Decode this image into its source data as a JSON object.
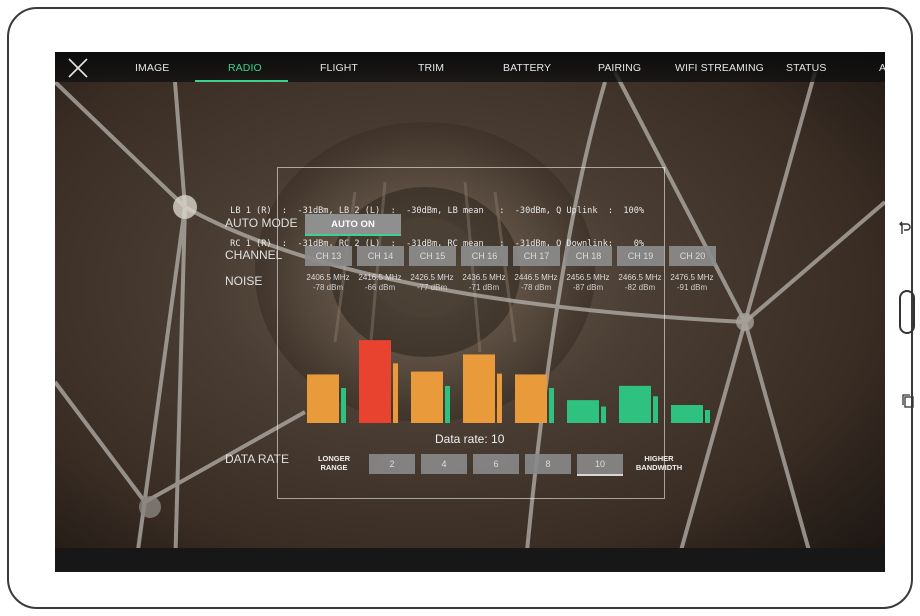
{
  "nav": {
    "tabs": [
      "IMAGE",
      "RADIO",
      "FLIGHT",
      "TRIM",
      "BATTERY",
      "PAIRING",
      "WIFI STREAMING",
      "STATUS",
      "A"
    ],
    "active_tab": "RADIO",
    "close_icon": "close-icon"
  },
  "stats": {
    "line1": " LB 1 (R)  :  -31dBm, LB 2 (L)  :  -30dBm, LB mean   :  -30dBm, Q Uplink  :  100%",
    "line2": " RC 1 (R)  :  -31dBm, RC 2 (L)  :  -31dBm, RC mean   :  -31dBm, Q Downlink:    0%"
  },
  "labels": {
    "auto_mode": "AUTO MODE",
    "channel": "CHANNEL",
    "noise": "NOISE",
    "data_rate": "DATA RATE"
  },
  "auto_button": "AUTO ON",
  "channels": [
    {
      "name": "CH 13",
      "freq": "2406.5 MHz",
      "noise": "-78 dBm"
    },
    {
      "name": "CH 14",
      "freq": "2416.5 MHz",
      "noise": "-66 dBm"
    },
    {
      "name": "CH 15",
      "freq": "2426.5 MHz",
      "noise": "-77 dBm"
    },
    {
      "name": "CH 16",
      "freq": "2436.5 MHz",
      "noise": "-71 dBm"
    },
    {
      "name": "CH 17",
      "freq": "2446.5 MHz",
      "noise": "-78 dBm"
    },
    {
      "name": "CH 18",
      "freq": "2456.5 MHz",
      "noise": "-87 dBm"
    },
    {
      "name": "CH 19",
      "freq": "2466.5 MHz",
      "noise": "-82 dBm"
    },
    {
      "name": "CH 20",
      "freq": "2476.5 MHz",
      "noise": "-91 dBm"
    }
  ],
  "data_rate": {
    "title": "Data rate: 10",
    "longer_range": "LONGER RANGE",
    "higher_bandwidth": "HIGHER BANDWIDTH",
    "options": [
      "2",
      "4",
      "6",
      "8",
      "10"
    ],
    "selected": "10"
  },
  "colors": {
    "accent": "#39d38c",
    "bar_green": "#2fc17f",
    "bar_orange": "#e99a3a",
    "bar_red": "#e8432f"
  }
}
